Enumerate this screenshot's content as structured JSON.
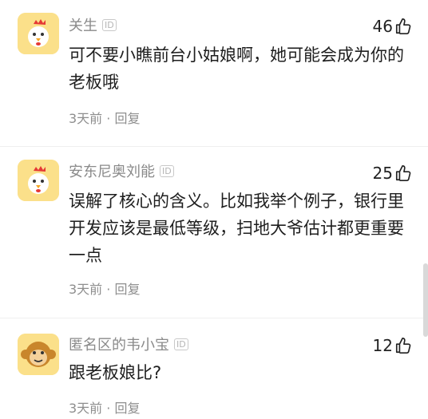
{
  "comments": [
    {
      "username": "关生",
      "id_badge": "ID",
      "likes": "46",
      "content": "可不要小瞧前台小姑娘啊，她可能会成为你的老板哦",
      "time": "3天前",
      "sep": "·",
      "reply": "回复",
      "avatar_icon": "chicken-avatar-icon"
    },
    {
      "username": "安东尼奥刘能",
      "id_badge": "ID",
      "likes": "25",
      "content": "误解了核心的含义。比如我举个例子，银行里开发应该是最低等级，扫地大爷估计都更重要一点",
      "time": "3天前",
      "sep": "·",
      "reply": "回复",
      "avatar_icon": "chicken-avatar-icon"
    },
    {
      "username": "匿名区的韦小宝",
      "id_badge": "ID",
      "likes": "12",
      "content": "跟老板娘比?",
      "time": "3天前",
      "sep": "·",
      "reply": "回复",
      "avatar_icon": "monkey-avatar-icon"
    }
  ],
  "colors": {
    "avatar_bg": "#fbe08a",
    "meta_text": "#8e8e8e",
    "body_text": "#1e1e1e"
  }
}
